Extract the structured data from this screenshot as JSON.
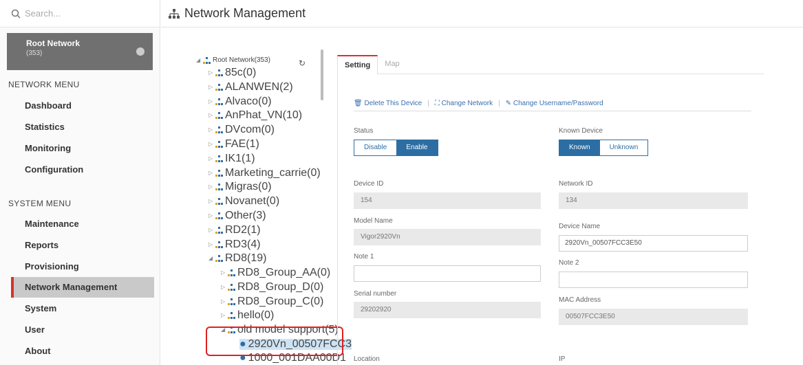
{
  "search": {
    "placeholder": "Search..."
  },
  "root_box": {
    "title": "Root Network",
    "count": "(353)"
  },
  "network_menu": {
    "title": "NETWORK MENU",
    "items": [
      "Dashboard",
      "Statistics",
      "Monitoring",
      "Configuration"
    ]
  },
  "system_menu": {
    "title": "SYSTEM MENU",
    "items": [
      "Maintenance",
      "Reports",
      "Provisioning",
      "Network Management",
      "System",
      "User",
      "About"
    ],
    "active": "Network Management"
  },
  "header": {
    "title": "Network Management"
  },
  "tree": {
    "root": "Root Network(353)",
    "nodes": [
      "85c(0)",
      "ALANWEN(2)",
      "Alvaco(0)",
      "AnPhat_VN(10)",
      "DVcom(0)",
      "FAE(1)",
      "IK1(1)",
      "Marketing_carrie(0)",
      "Migras(0)",
      "Novanet(0)",
      "Other(3)",
      "RD2(1)",
      "RD3(4)",
      "RD8(19)"
    ],
    "rd8_children": [
      "RD8_Group_AA(0)",
      "RD8_Group_D(0)",
      "RD8_Group_C(0)",
      "hello(0)",
      "old model support(5)"
    ],
    "devices": [
      "2920Vn_00507FCC3",
      "1000_001DAA00D1"
    ]
  },
  "tabs": [
    "Setting",
    "Map"
  ],
  "actions": [
    "Delete This Device",
    "Change Network",
    "Change Username/Password"
  ],
  "form": {
    "status_label": "Status",
    "status_options": [
      "Disable",
      "Enable"
    ],
    "known_label": "Known Device",
    "known_options": [
      "Known",
      "Unknown"
    ],
    "device_id_label": "Device ID",
    "device_id": "154",
    "network_id_label": "Network ID",
    "network_id": "134",
    "model_name_label": "Model Name",
    "model_name": "Vigor2920Vn",
    "device_name_label": "Device Name",
    "device_name": "2920Vn_00507FCC3E50",
    "note1_label": "Note 1",
    "note1": "",
    "note2_label": "Note 2",
    "note2": "",
    "serial_label": "Serial number",
    "serial": "29202920",
    "mac_label": "MAC Address",
    "mac": "00507FCC3E50",
    "location_label": "Location",
    "ip_label": "IP"
  },
  "colors": {
    "accent": "#d4342b",
    "primary": "#2c6ea3",
    "sidebar_active": "#c9c9c9"
  }
}
